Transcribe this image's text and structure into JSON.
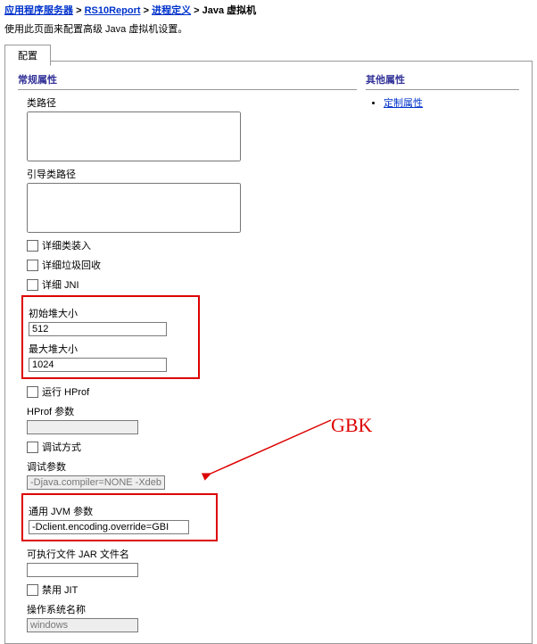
{
  "breadcrumb": {
    "a1": "应用程序服务器",
    "a2": "RS10Report",
    "a3": "进程定义",
    "current": "Java 虚拟机",
    "sep": ">"
  },
  "desc": "使用此页面来配置高级 Java 虚拟机设置。",
  "tab": "配置",
  "section_general": "常规属性",
  "section_other": "其他属性",
  "right_link": "定制属性",
  "labels": {
    "classpath": "类路径",
    "bootcp": "引导类路径",
    "verboseClass": "详细类装入",
    "verboseGC": "详细垃圾回收",
    "verboseJNI": "详细 JNI",
    "initHeap": "初始堆大小",
    "maxHeap": "最大堆大小",
    "runHprof": "运行 HProf",
    "hprofArgs": "HProf 参数",
    "debugMode": "调试方式",
    "debugArgs": "调试参数",
    "genericJvm": "通用 JVM 参数",
    "execJar": "可执行文件 JAR 文件名",
    "disableJIT": "禁用 JIT",
    "osName": "操作系统名称"
  },
  "values": {
    "initHeap": "512",
    "maxHeap": "1024",
    "debugArgs": "-Djava.compiler=NONE -Xdebu",
    "genericJvm": "-Dclient.encoding.override=GBI",
    "osName": "windows"
  },
  "annotation": "GBK"
}
